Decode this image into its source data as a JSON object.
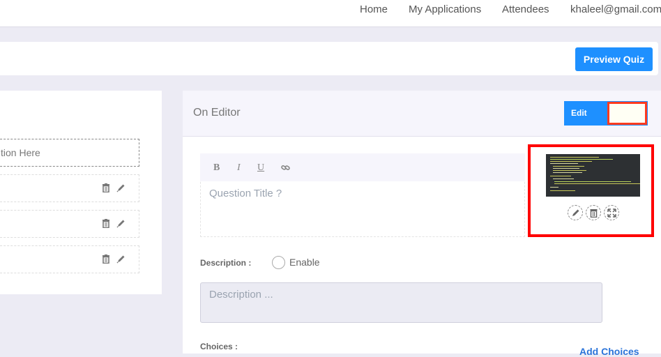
{
  "nav": {
    "home": "Home",
    "applications": "My Applications",
    "attendees": "Attendees",
    "user": "khaleel@gmail.com"
  },
  "toolbar": {
    "preview_label": "Preview Quiz"
  },
  "questions": {
    "add_placeholder": "Add Question Here",
    "add_visible": "tion Here",
    "items": [
      {
        "title": ""
      },
      {
        "title": ""
      },
      {
        "title": ""
      }
    ]
  },
  "editor": {
    "title": "On Editor",
    "edit_label": "Edit",
    "format_buttons": {
      "bold": "B",
      "italic": "I",
      "underline": "U",
      "link": "link-icon"
    },
    "question_placeholder": "Question Title ?",
    "description_label": "Description :",
    "enable_label": "Enable",
    "description_placeholder": "Description ...",
    "choices_label": "Choices :",
    "add_choices_label": "Add Choices"
  },
  "colors": {
    "accent": "#1e90ff",
    "highlight": "#ff0000",
    "background": "#ecebf4"
  }
}
